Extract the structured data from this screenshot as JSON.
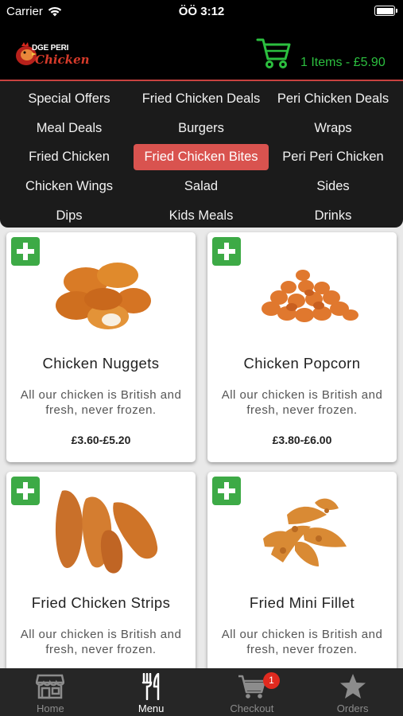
{
  "status_bar": {
    "carrier": "Carrier",
    "time": "ÖÖ 3:12"
  },
  "header": {
    "logo_line1": "DGE PERI",
    "logo_line2": "Chicken",
    "cart_summary": "1 Items - £5.90",
    "accent_color": "#2cbf3f"
  },
  "categories": [
    {
      "label": "Special Offers"
    },
    {
      "label": "Fried Chicken Deals"
    },
    {
      "label": "Peri Chicken Deals"
    },
    {
      "label": "Meal Deals"
    },
    {
      "label": "Burgers"
    },
    {
      "label": "Wraps"
    },
    {
      "label": "Fried Chicken"
    },
    {
      "label": "Fried Chicken Bites",
      "active": true
    },
    {
      "label": "Peri Peri Chicken"
    },
    {
      "label": "Chicken Wings"
    },
    {
      "label": "Salad"
    },
    {
      "label": "Sides"
    },
    {
      "label": "Dips"
    },
    {
      "label": "Kids Meals"
    },
    {
      "label": "Drinks"
    }
  ],
  "products": [
    {
      "name": "Chicken Nuggets",
      "description": "All our chicken is British and fresh, never frozen.",
      "price": "£3.60-£5.20",
      "image_icon": "chicken-nuggets-image"
    },
    {
      "name": "Chicken Popcorn",
      "description": "All our chicken is British and fresh, never frozen.",
      "price": "£3.80-£6.00",
      "image_icon": "chicken-popcorn-image"
    },
    {
      "name": "Fried Chicken Strips",
      "description": "All our chicken is British and fresh, never frozen.",
      "price": "",
      "image_icon": "chicken-strips-image"
    },
    {
      "name": "Fried Mini Fillet",
      "description": "All our chicken is British and fresh, never frozen.",
      "price": "",
      "image_icon": "mini-fillet-image"
    }
  ],
  "tabbar": {
    "items": [
      {
        "label": "Home",
        "icon": "store-icon"
      },
      {
        "label": "Menu",
        "icon": "cutlery-icon",
        "active": true
      },
      {
        "label": "Checkout",
        "icon": "cart-icon"
      },
      {
        "label": "Orders",
        "icon": "star-icon"
      }
    ],
    "checkout_badge": "1"
  },
  "colors": {
    "active_category": "#d9534f",
    "add_button": "#3daa46",
    "badge": "#e02a1f"
  }
}
